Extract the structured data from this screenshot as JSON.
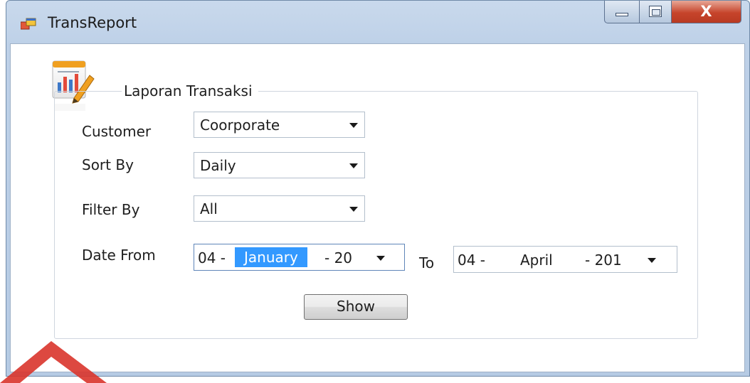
{
  "window": {
    "title": "TransReport",
    "icon": "app-window-icon",
    "controls": {
      "minimize": "minimize-icon",
      "maximize": "maximize-icon",
      "close_glyph": "X"
    }
  },
  "form": {
    "group_title": "Laporan Transaksi",
    "report_icon": "report-chart-icon",
    "fields": {
      "customer": {
        "label": "Customer",
        "value": "Coorporate"
      },
      "sort_by": {
        "label": "Sort By",
        "value": "Daily"
      },
      "filter_by": {
        "label": "Filter By",
        "value": "All"
      },
      "date_from": {
        "label": "Date From",
        "day": "04 -",
        "month": "January",
        "year": "- 20"
      },
      "date_to": {
        "label": "To",
        "day": "04 -",
        "month": "April",
        "year": "- 201"
      }
    },
    "show_button": "Show"
  },
  "colors": {
    "selection": "#3399ff",
    "close_button": "#c6442b",
    "titlebar": "#c9d9ec",
    "watermark": "#d9342b"
  }
}
